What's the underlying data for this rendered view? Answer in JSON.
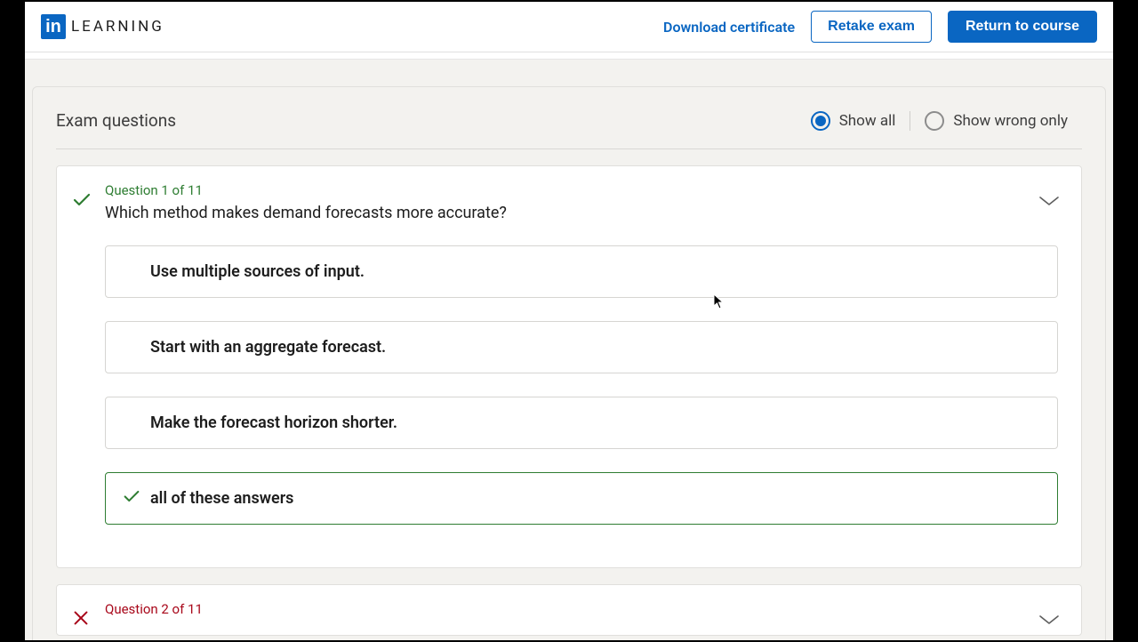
{
  "header": {
    "logo_badge": "in",
    "logo_text": "LEARNING",
    "download_label": "Download certificate",
    "retake_label": "Retake exam",
    "return_label": "Return to course"
  },
  "panel": {
    "title": "Exam questions",
    "filter": {
      "show_all": "Show all",
      "show_wrong": "Show wrong only"
    }
  },
  "questions": [
    {
      "number": "Question 1 of 11",
      "status": "correct",
      "text": "Which method makes demand forecasts more accurate?",
      "answers": [
        {
          "text": "Use multiple sources of input.",
          "correct": false
        },
        {
          "text": "Start with an aggregate forecast.",
          "correct": false
        },
        {
          "text": "Make the forecast horizon shorter.",
          "correct": false
        },
        {
          "text": "all of these answers",
          "correct": true
        }
      ]
    },
    {
      "number": "Question 2 of 11",
      "status": "wrong",
      "text": "",
      "answers": []
    }
  ]
}
